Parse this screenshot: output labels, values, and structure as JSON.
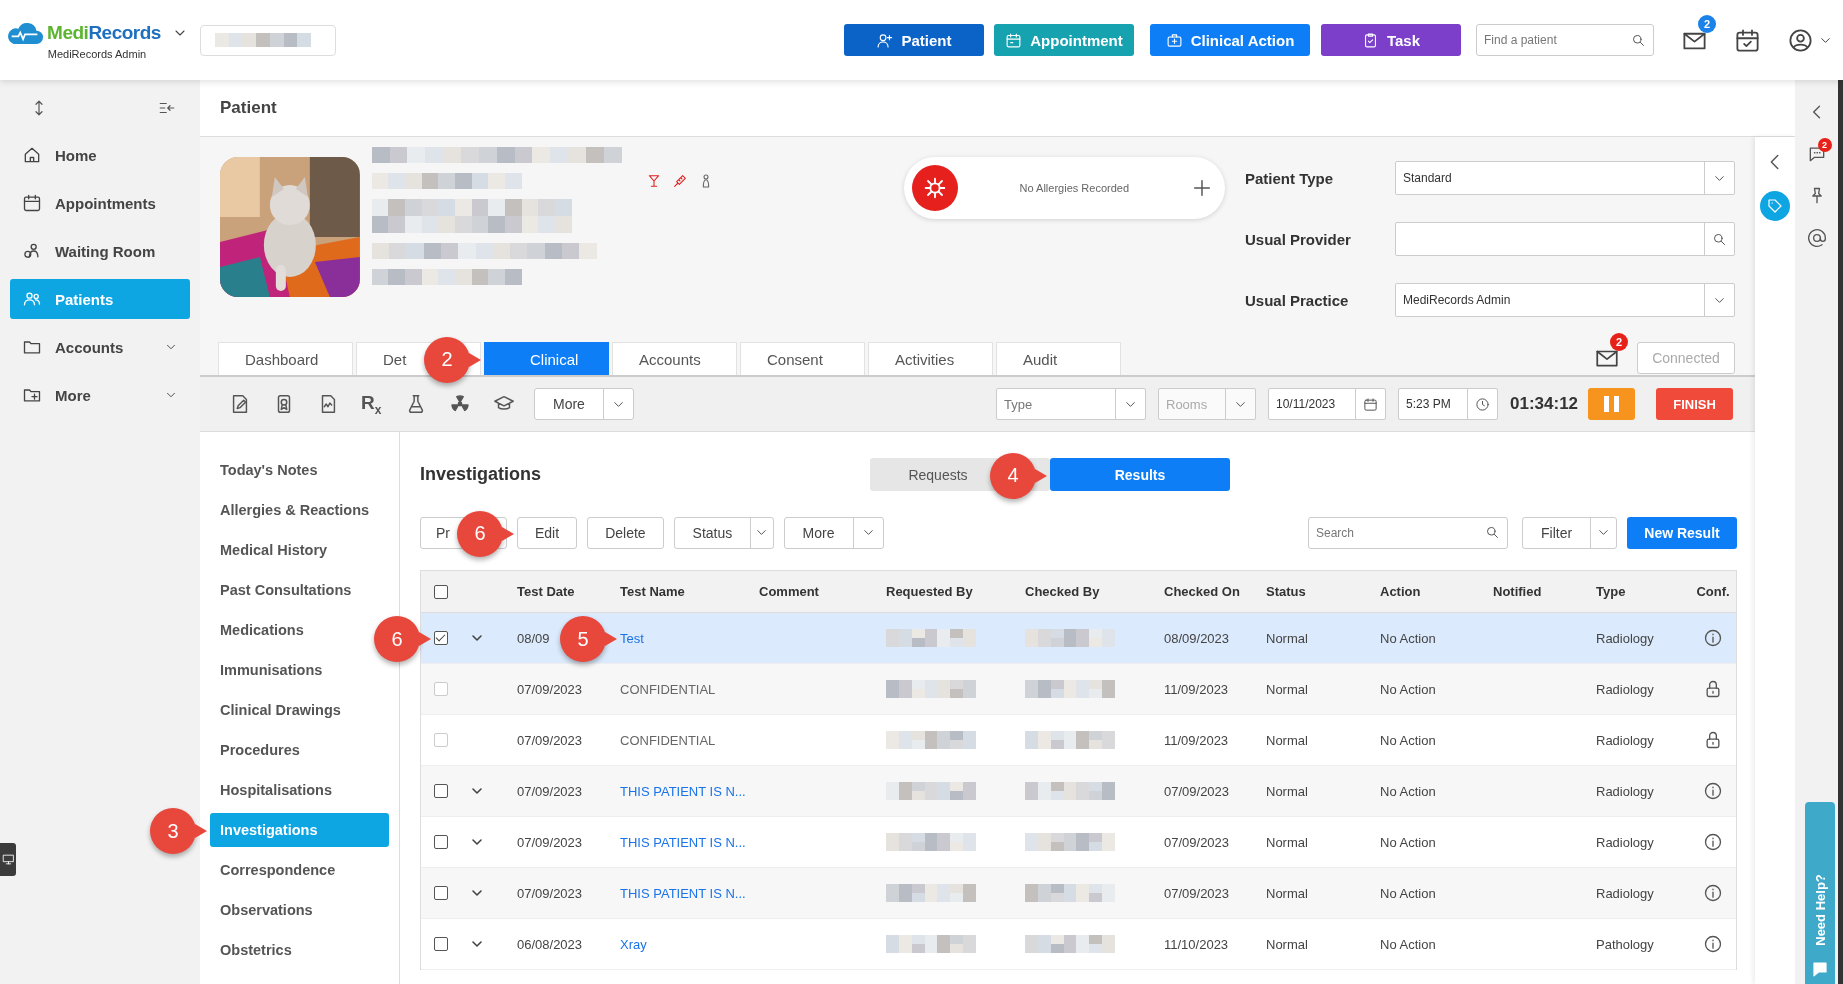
{
  "topbar": {
    "brand": [
      {
        "text": "Medi",
        "color": "#5cb531"
      },
      {
        "text": "Records",
        "color": "#1f6fbf"
      }
    ],
    "brand_subtitle": "MediRecords Admin",
    "practice_selector": {
      "kind": "pixelated"
    },
    "actions": [
      {
        "label": "Patient",
        "kind": "patient",
        "color": "#0b63c8"
      },
      {
        "label": "Appointment",
        "kind": "appointment",
        "color": "#17a2b0"
      },
      {
        "label": "Clinical Action",
        "kind": "clinical",
        "color": "#0d7ef5"
      },
      {
        "label": "Task",
        "kind": "task",
        "color": "#7b3fc9"
      }
    ],
    "search": {
      "placeholder": "Find a patient"
    },
    "mail_badge": "2"
  },
  "sidebar": {
    "items": [
      {
        "label": "Home",
        "kind": "home",
        "selected": false,
        "expandable": false
      },
      {
        "label": "Appointments",
        "kind": "calendar",
        "selected": false,
        "expandable": false
      },
      {
        "label": "Waiting Room",
        "kind": "waiting",
        "selected": false,
        "expandable": false
      },
      {
        "label": "Patients",
        "kind": "people",
        "selected": true,
        "expandable": false
      },
      {
        "label": "Accounts",
        "kind": "folder",
        "selected": false,
        "expandable": true
      },
      {
        "label": "More",
        "kind": "folder-plus",
        "selected": false,
        "expandable": true
      }
    ]
  },
  "page_title": "Patient",
  "patient": {
    "details": [
      {
        "kind": "pixelated"
      },
      {
        "kind": "pixelated"
      },
      {
        "kind": "pixelated"
      },
      {
        "kind": "pixelated"
      },
      {
        "kind": "pixelated"
      }
    ],
    "allergy": {
      "text": "No Allergies Recorded"
    },
    "fields": [
      {
        "label": "Patient Type",
        "value": "Standard",
        "kind": "select"
      },
      {
        "label": "Usual Provider",
        "kind": "search"
      },
      {
        "label": "Usual Practice",
        "value": "MediRecords Admin",
        "kind": "select"
      }
    ],
    "tabs": [
      {
        "label": "Dashboard",
        "selected": false
      },
      {
        "label": "Det",
        "selected": false
      },
      {
        "label": "Clinical",
        "selected": true,
        "callout": "2"
      },
      {
        "label": "Accounts",
        "selected": false
      },
      {
        "label": "Consent",
        "selected": false
      },
      {
        "label": "Activities",
        "selected": false
      },
      {
        "label": "Audit",
        "selected": false
      }
    ],
    "message_badge": "2",
    "connection": {
      "label": "Connected",
      "disabled": true
    }
  },
  "toolbar": {
    "prescription": "R$_{x}$",
    "more": "More",
    "type": {
      "placeholder": "Type"
    },
    "rooms": {
      "placeholder": "Rooms",
      "disabled": true
    },
    "date": "10/11/2023",
    "time": "5:23 PM",
    "timer": "01:34:12",
    "finish": "FINISH"
  },
  "clinical_nav": [
    {
      "label": "Today's Notes",
      "selected": false
    },
    {
      "label": "Allergies & Reactions",
      "selected": false
    },
    {
      "label": "Medical History",
      "selected": false
    },
    {
      "label": "Past Consultations",
      "selected": false
    },
    {
      "label": "Medications",
      "selected": false
    },
    {
      "label": "Immunisations",
      "selected": false
    },
    {
      "label": "Clinical Drawings",
      "selected": false
    },
    {
      "label": "Procedures",
      "selected": false
    },
    {
      "label": "Hospitalisations",
      "selected": false
    },
    {
      "label": "Investigations",
      "selected": true,
      "callout": "3"
    },
    {
      "label": "Correspondence",
      "selected": false
    },
    {
      "label": "Observations",
      "selected": false
    },
    {
      "label": "Obstetrics",
      "selected": false
    }
  ],
  "investigations": {
    "title": "Investigations",
    "views": [
      {
        "label": "Requests",
        "selected": false
      },
      {
        "label": "Results",
        "selected": true,
        "callout": "4"
      }
    ],
    "actions": [
      {
        "label": "Pr",
        "kind": "button"
      },
      {
        "label": "Edit",
        "kind": "button",
        "callout": "6"
      },
      {
        "label": "Delete",
        "kind": "button"
      },
      {
        "label": "Status",
        "kind": "split"
      },
      {
        "label": "More",
        "kind": "split"
      }
    ],
    "search": {
      "placeholder": "Search"
    },
    "filter": "Filter",
    "new_button": "New Result",
    "table": {
      "all_checked": false,
      "columns": [
        "Test Date",
        "Test Name",
        "Comment",
        "Requested By",
        "Checked By",
        "Checked On",
        "Status",
        "Action",
        "Notified",
        "Type",
        "Conf."
      ],
      "rows": [
        {
          "selected": true,
          "checked": true,
          "disabled": false,
          "expandable": true,
          "confidential": false,
          "callout": "6",
          "test_date": "08/09",
          "test_name": "Test",
          "name_callout": "5",
          "requested_by": {
            "kind": "pixelated"
          },
          "checked_by": {
            "kind": "pixelated"
          },
          "checked_on": "08/09/2023",
          "status": "Normal",
          "action": "No Action",
          "type": "Radiology"
        },
        {
          "selected": false,
          "checked": false,
          "disabled": true,
          "expandable": false,
          "confidential": true,
          "test_date": "07/09/2023",
          "test_name": "CONFIDENTIAL",
          "requested_by": {
            "kind": "pixelated"
          },
          "checked_by": {
            "kind": "pixelated"
          },
          "checked_on": "11/09/2023",
          "status": "Normal",
          "action": "No Action",
          "type": "Radiology"
        },
        {
          "selected": false,
          "checked": false,
          "disabled": true,
          "expandable": false,
          "confidential": true,
          "test_date": "07/09/2023",
          "test_name": "CONFIDENTIAL",
          "requested_by": {
            "kind": "pixelated"
          },
          "checked_by": {
            "kind": "pixelated"
          },
          "checked_on": "11/09/2023",
          "status": "Normal",
          "action": "No Action",
          "type": "Radiology"
        },
        {
          "selected": false,
          "checked": false,
          "disabled": false,
          "expandable": true,
          "confidential": false,
          "test_date": "07/09/2023",
          "test_name": "THIS PATIENT IS N...",
          "requested_by": {
            "kind": "pixelated"
          },
          "checked_by": {
            "kind": "pixelated"
          },
          "checked_on": "07/09/2023",
          "status": "Normal",
          "action": "No Action",
          "type": "Radiology"
        },
        {
          "selected": false,
          "checked": false,
          "disabled": false,
          "expandable": true,
          "confidential": false,
          "test_date": "07/09/2023",
          "test_name": "THIS PATIENT IS N...",
          "requested_by": {
            "kind": "pixelated"
          },
          "checked_by": {
            "kind": "pixelated"
          },
          "checked_on": "07/09/2023",
          "status": "Normal",
          "action": "No Action",
          "type": "Radiology"
        },
        {
          "selected": false,
          "checked": false,
          "disabled": false,
          "expandable": true,
          "confidential": false,
          "test_date": "07/09/2023",
          "test_name": "THIS PATIENT IS N...",
          "requested_by": {
            "kind": "pixelated"
          },
          "checked_by": {
            "kind": "pixelated"
          },
          "checked_on": "07/09/2023",
          "status": "Normal",
          "action": "No Action",
          "type": "Radiology"
        },
        {
          "selected": false,
          "checked": false,
          "disabled": false,
          "expandable": true,
          "confidential": false,
          "test_date": "06/08/2023",
          "test_name": "Xray",
          "requested_by": {
            "kind": "pixelated"
          },
          "checked_by": {
            "kind": "pixelated"
          },
          "checked_on": "11/10/2023",
          "status": "Normal",
          "action": "No Action",
          "type": "Pathology"
        }
      ]
    }
  },
  "right_rail": {
    "chat_badge": "2",
    "help": "Need Help?"
  }
}
